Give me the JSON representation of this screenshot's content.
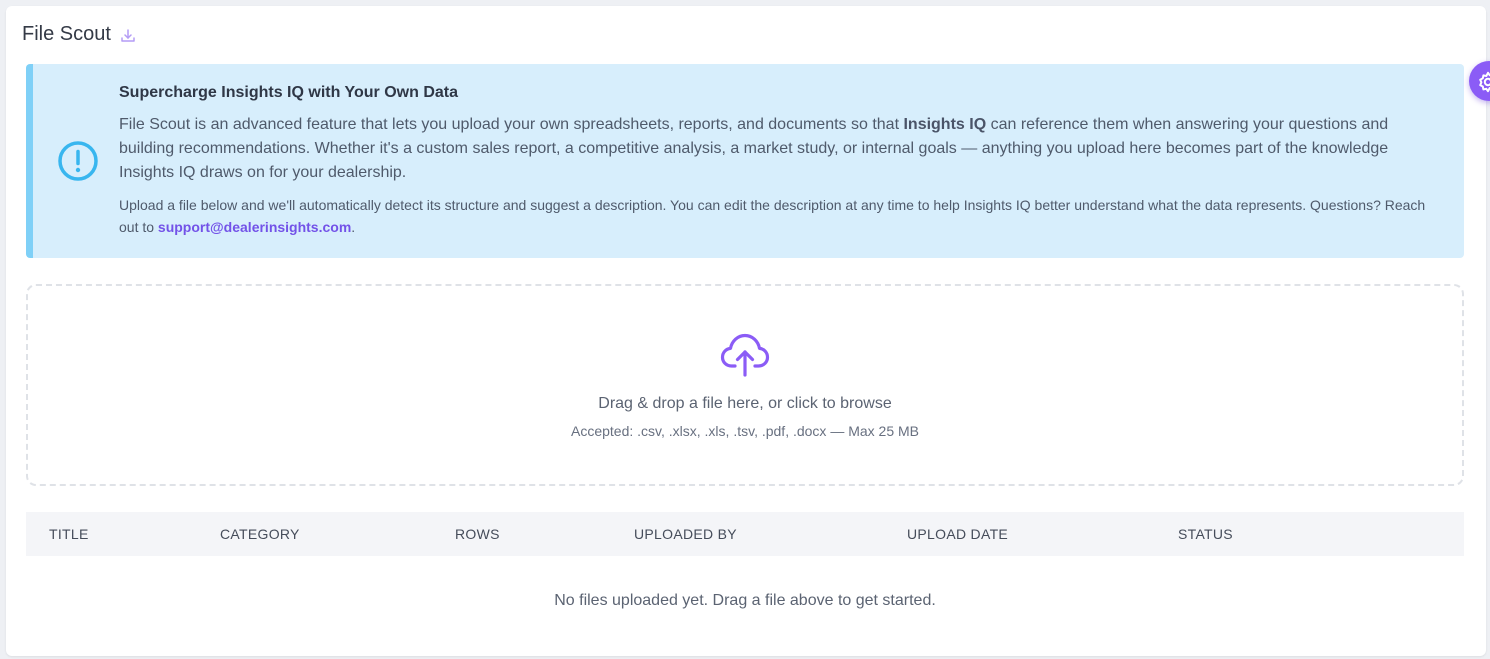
{
  "header": {
    "title": "File Scout",
    "download_icon": "download-icon"
  },
  "banner": {
    "icon": "exclamation-circle-icon",
    "title": "Supercharge Insights IQ with Your Own Data",
    "body_pre": "File Scout is an advanced feature that lets you upload your own spreadsheets, reports, and documents so that ",
    "body_bold": "Insights IQ",
    "body_post": " can reference them when answering your questions and building recommendations. Whether it's a custom sales report, a competitive analysis, a market study, or internal goals — anything you upload here becomes part of the knowledge Insights IQ draws on for your dealership.",
    "small_pre": "Upload a file below and we'll automatically detect its structure and suggest a description. You can edit the description at any time to help Insights IQ better understand what the data represents. Questions? Reach out to ",
    "support_email": "support@dealerinsights.com",
    "small_post": "."
  },
  "dropzone": {
    "icon": "cloud-upload-icon",
    "main_text": "Drag & drop a file here, or click to browse",
    "sub_text": "Accepted: .csv, .xlsx, .xls, .tsv, .pdf, .docx — Max 25 MB"
  },
  "table": {
    "columns": [
      "TITLE",
      "CATEGORY",
      "ROWS",
      "UPLOADED BY",
      "UPLOAD DATE",
      "STATUS"
    ],
    "empty_text": "No files uploaded yet. Drag a file above to get started."
  },
  "fab": {
    "icon": "gear-icon"
  },
  "colors": {
    "accent": "#8b5cf6",
    "banner_bg": "#d7eefc",
    "banner_border": "#7fd0f7",
    "info_icon": "#38b6ef",
    "link": "#7352e8"
  }
}
